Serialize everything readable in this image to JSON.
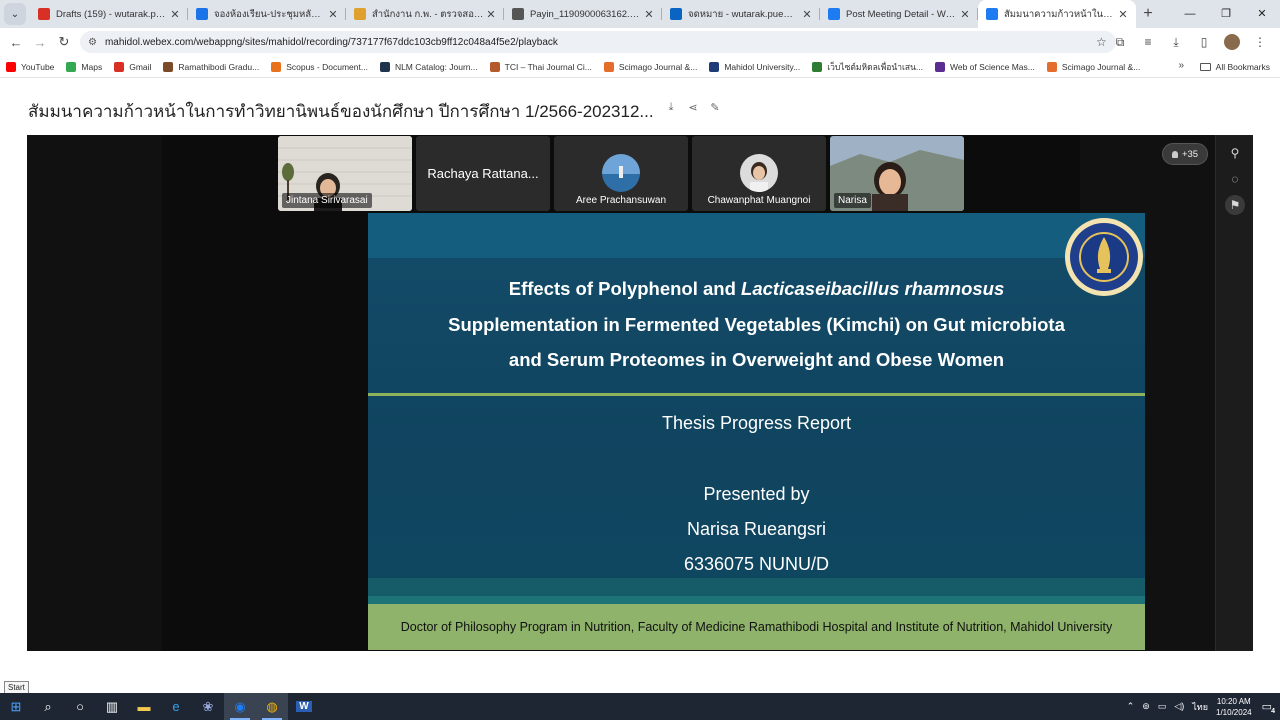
{
  "browser": {
    "tabs": [
      {
        "label": "Drafts (159) - wutarak.pue@m...",
        "icon": "gmail-icon",
        "color": "#d93025"
      },
      {
        "label": "จองห้องเรียน-ประชุมหลักสูตร",
        "icon": "calendar-icon",
        "color": "#1a73e8"
      },
      {
        "label": "สำนักงาน ก.พ. - ตรวจสอบสถานะ...",
        "icon": "emblem-icon",
        "color": "#e0a030"
      },
      {
        "label": "Payin_1190900063162.pdf",
        "icon": "globe-icon",
        "color": "#555555"
      },
      {
        "label": "จดหมาย - wutarak.pue@mahid...",
        "icon": "outlook-icon",
        "color": "#0a64c2"
      },
      {
        "label": "Post Meeting Detail - Webex",
        "icon": "webex-icon",
        "color": "#1d7cf2"
      },
      {
        "label": "สัมมนาความก้าวหน้าในการทำวิ...",
        "icon": "webex-icon",
        "color": "#1d7cf2",
        "active": true
      }
    ],
    "url": "mahidol.webex.com/webappng/sites/mahidol/recording/737177f67ddc103cb9ff12c048a4f5e2/playback",
    "bookmarks": [
      {
        "label": "YouTube",
        "color": "#ff0000"
      },
      {
        "label": "Maps",
        "color": "#34a853"
      },
      {
        "label": "Gmail",
        "color": "#d93025"
      },
      {
        "label": "Ramathibodi Gradu...",
        "color": "#7a4a2a"
      },
      {
        "label": "Scopus - Document...",
        "color": "#e9711c"
      },
      {
        "label": "NLM Catalog: Journ...",
        "color": "#20344f"
      },
      {
        "label": "TCI – Thai Journal Ci...",
        "color": "#b55a2a"
      },
      {
        "label": "Scimago Journal &...",
        "color": "#e46d2c"
      },
      {
        "label": "Mahidol University...",
        "color": "#1e3c78"
      },
      {
        "label": "เว็บไซต์มหิดลเพื่อนำเสน...",
        "color": "#2e7d32"
      },
      {
        "label": "Web of Science Mas...",
        "color": "#5b2d91"
      },
      {
        "label": "Scimago Journal &...",
        "color": "#e46d2c"
      }
    ],
    "all_bookmarks": "All Bookmarks"
  },
  "page": {
    "title": "สัมมนาความก้าวหน้าในการทำวิทยานิพนธ์ของนักศึกษา ปีการศึกษา 1/2566-202312..."
  },
  "participants": {
    "tiles": [
      {
        "name": "Jintana Sirivarasai"
      },
      {
        "name": "Rachaya Rattana..."
      },
      {
        "name": "Aree Prachansuwan"
      },
      {
        "name": "Chawanphat Muangnoi"
      },
      {
        "name": "Narisa"
      }
    ],
    "more": "+35"
  },
  "slide": {
    "title_line1_a": "Effects of Polyphenol and ",
    "title_line1_b": "Lacticaseibacillus rhamnosus",
    "title_line2": "Supplementation in Fermented Vegetables (Kimchi) on Gut microbiota",
    "title_line3": "and Serum Proteomes in Overweight and Obese Women",
    "report": "Thesis Progress Report",
    "presented_by": "Presented by",
    "presenter": "Narisa Rueangsri",
    "student_id": "6336075 NUNU/D",
    "footer": "Doctor of Philosophy Program in Nutrition, Faculty of Medicine Ramathibodi Hospital and Institute of Nutrition, Mahidol University"
  },
  "taskbar": {
    "start_tooltip": "Start",
    "language": "ไทย",
    "time": "10:20 AM",
    "date": "1/10/2024",
    "notifications": "4"
  }
}
